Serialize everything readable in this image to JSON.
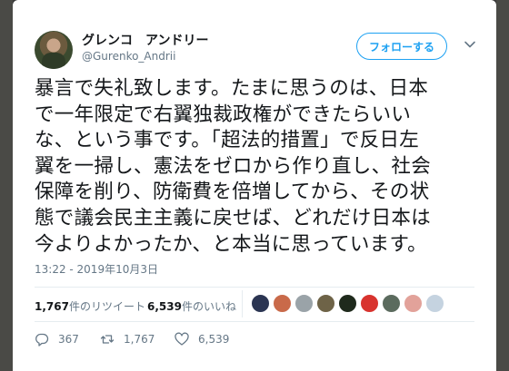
{
  "tweet": {
    "user": {
      "display_name": "グレンコ　アンドリー",
      "handle": "@Gurenko_Andrii"
    },
    "follow_label": "フォローする",
    "text_lines": [
      "暴言で失礼致します。たまに思うのは、日本",
      "で一年限定で右翼独裁政権ができたらいい",
      "な、という事です。「超法的措置」で反日左",
      "翼を一掃し、憲法をゼロから作り直し、社会",
      "保障を削り、防衛費を倍増してから、その状",
      "態で議会民主主義に戻せば、どれだけ日本は",
      "今よりよかったか、と本当に思っています。"
    ],
    "timestamp": "13:22 - 2019年10月3日",
    "stats": {
      "retweets_count": "1,767",
      "retweets_label": "件のリツイート",
      "likes_count": "6,539",
      "likes_label": "件のいいね"
    },
    "actions": {
      "replies": "367",
      "retweets": "1,767",
      "likes": "6,539"
    }
  },
  "icons": {
    "menu": "chevron-down-icon",
    "reply": "reply-icon",
    "retweet": "retweet-icon",
    "like": "heart-icon"
  },
  "colors": {
    "accent": "#1da1f2",
    "secondary_text": "#657786",
    "primary_text": "#14171a"
  }
}
